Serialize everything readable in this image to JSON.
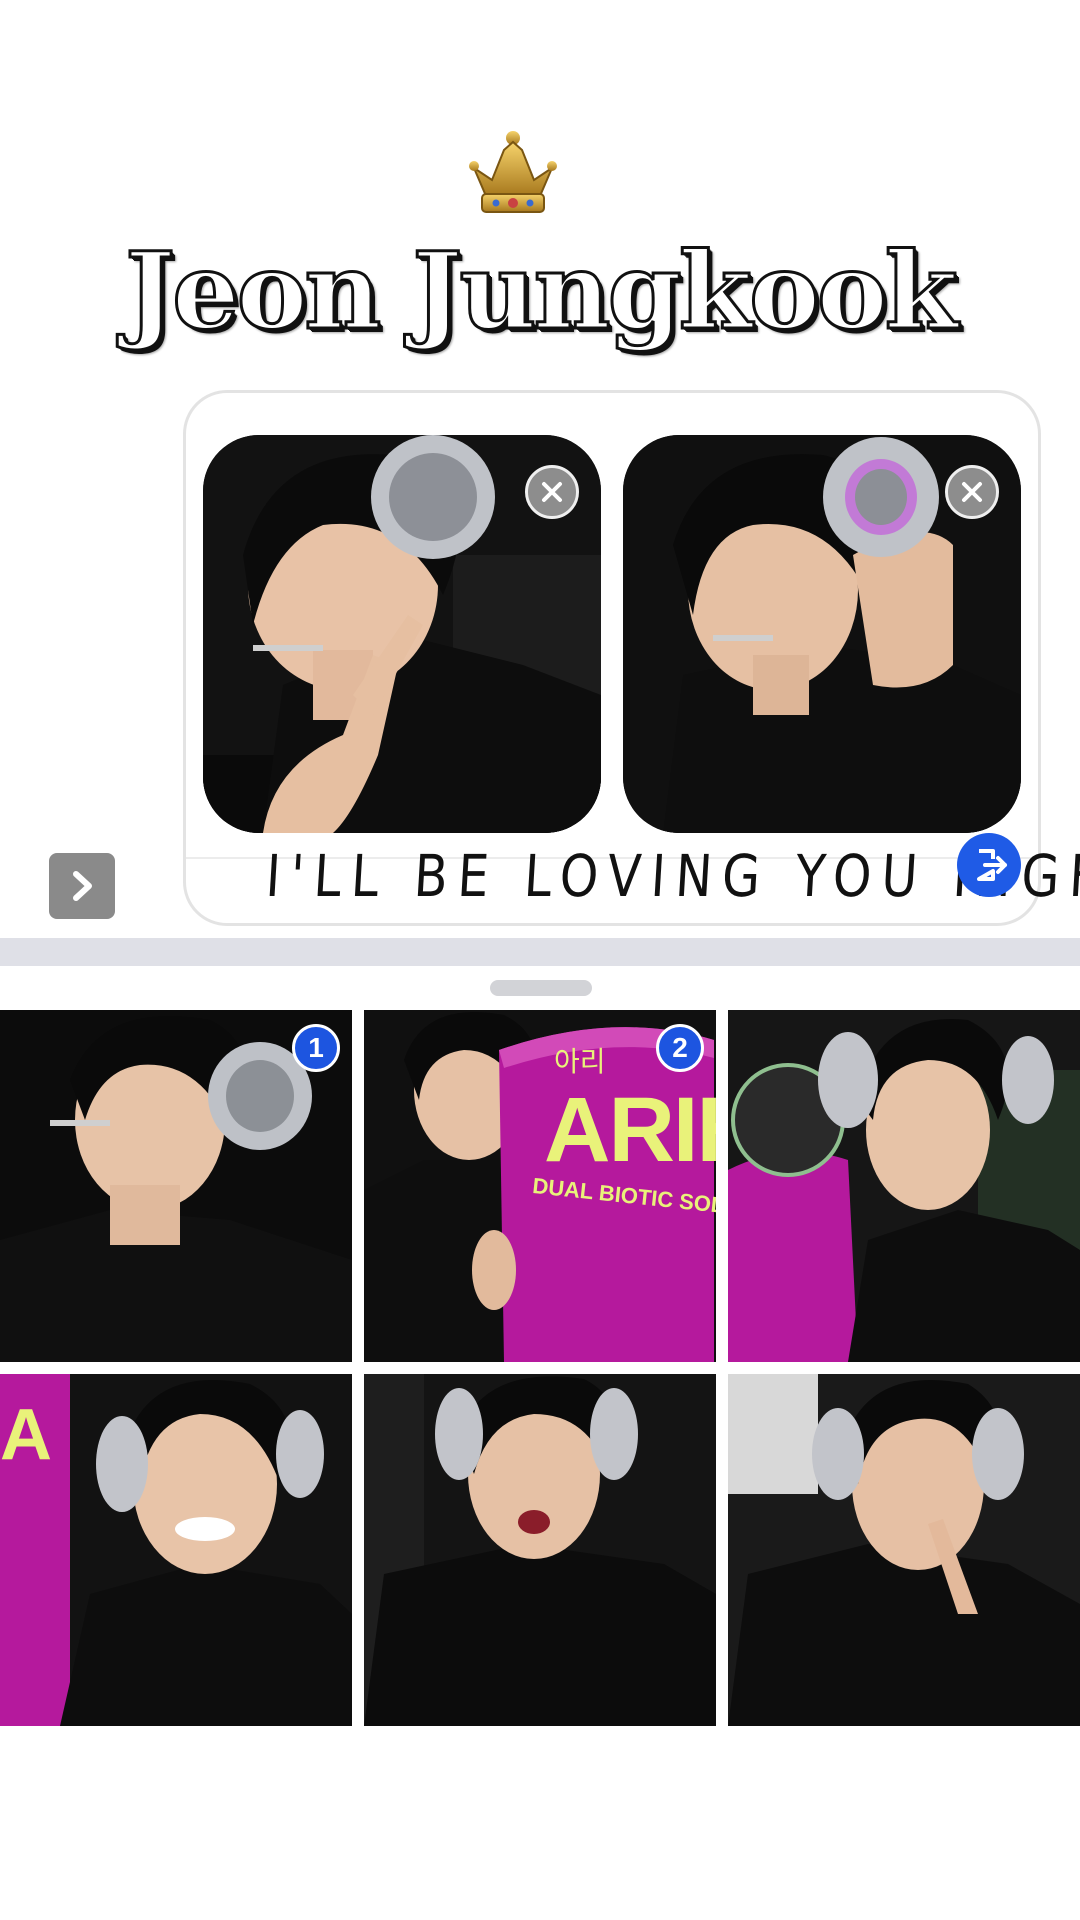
{
  "header": {
    "crown_icon": "crown-icon",
    "title": "Jeon Jungkook"
  },
  "composer": {
    "attachments": [
      {
        "photo_icon": "photo-thumbnail",
        "remove_icon": "close-icon"
      },
      {
        "photo_icon": "photo-thumbnail",
        "remove_icon": "close-icon"
      }
    ],
    "message_text": "I'LL BE LOVING YOU RIGHT",
    "send_icon": "send-icon",
    "expand_icon": "chevron-right-icon"
  },
  "photo_picker": {
    "grabber": "drag-handle",
    "items": [
      {
        "badge": "1",
        "selected": true
      },
      {
        "badge": "2",
        "selected": true,
        "can_text": "ARIH",
        "can_subtext": "DUAL BIOTIC SODA",
        "can_korean": "아리"
      },
      {
        "badge": "",
        "selected": false
      },
      {
        "badge": "",
        "selected": false
      },
      {
        "badge": "",
        "selected": false
      },
      {
        "badge": "",
        "selected": false
      }
    ]
  },
  "colors": {
    "accent": "#1f5be6",
    "can": "#b5199d",
    "can_text": "#e9f27a",
    "shirt": "#0d0d0d",
    "headphone": "#b9bcc2"
  }
}
